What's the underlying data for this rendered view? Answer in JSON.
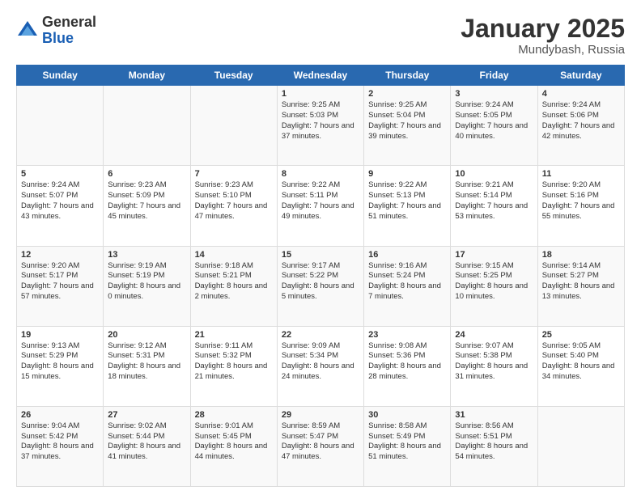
{
  "header": {
    "logo_general": "General",
    "logo_blue": "Blue",
    "month": "January 2025",
    "location": "Mundybash, Russia"
  },
  "weekdays": [
    "Sunday",
    "Monday",
    "Tuesday",
    "Wednesday",
    "Thursday",
    "Friday",
    "Saturday"
  ],
  "weeks": [
    [
      {
        "day": "",
        "info": ""
      },
      {
        "day": "",
        "info": ""
      },
      {
        "day": "",
        "info": ""
      },
      {
        "day": "1",
        "info": "Sunrise: 9:25 AM\nSunset: 5:03 PM\nDaylight: 7 hours and 37 minutes."
      },
      {
        "day": "2",
        "info": "Sunrise: 9:25 AM\nSunset: 5:04 PM\nDaylight: 7 hours and 39 minutes."
      },
      {
        "day": "3",
        "info": "Sunrise: 9:24 AM\nSunset: 5:05 PM\nDaylight: 7 hours and 40 minutes."
      },
      {
        "day": "4",
        "info": "Sunrise: 9:24 AM\nSunset: 5:06 PM\nDaylight: 7 hours and 42 minutes."
      }
    ],
    [
      {
        "day": "5",
        "info": "Sunrise: 9:24 AM\nSunset: 5:07 PM\nDaylight: 7 hours and 43 minutes."
      },
      {
        "day": "6",
        "info": "Sunrise: 9:23 AM\nSunset: 5:09 PM\nDaylight: 7 hours and 45 minutes."
      },
      {
        "day": "7",
        "info": "Sunrise: 9:23 AM\nSunset: 5:10 PM\nDaylight: 7 hours and 47 minutes."
      },
      {
        "day": "8",
        "info": "Sunrise: 9:22 AM\nSunset: 5:11 PM\nDaylight: 7 hours and 49 minutes."
      },
      {
        "day": "9",
        "info": "Sunrise: 9:22 AM\nSunset: 5:13 PM\nDaylight: 7 hours and 51 minutes."
      },
      {
        "day": "10",
        "info": "Sunrise: 9:21 AM\nSunset: 5:14 PM\nDaylight: 7 hours and 53 minutes."
      },
      {
        "day": "11",
        "info": "Sunrise: 9:20 AM\nSunset: 5:16 PM\nDaylight: 7 hours and 55 minutes."
      }
    ],
    [
      {
        "day": "12",
        "info": "Sunrise: 9:20 AM\nSunset: 5:17 PM\nDaylight: 7 hours and 57 minutes."
      },
      {
        "day": "13",
        "info": "Sunrise: 9:19 AM\nSunset: 5:19 PM\nDaylight: 8 hours and 0 minutes."
      },
      {
        "day": "14",
        "info": "Sunrise: 9:18 AM\nSunset: 5:21 PM\nDaylight: 8 hours and 2 minutes."
      },
      {
        "day": "15",
        "info": "Sunrise: 9:17 AM\nSunset: 5:22 PM\nDaylight: 8 hours and 5 minutes."
      },
      {
        "day": "16",
        "info": "Sunrise: 9:16 AM\nSunset: 5:24 PM\nDaylight: 8 hours and 7 minutes."
      },
      {
        "day": "17",
        "info": "Sunrise: 9:15 AM\nSunset: 5:25 PM\nDaylight: 8 hours and 10 minutes."
      },
      {
        "day": "18",
        "info": "Sunrise: 9:14 AM\nSunset: 5:27 PM\nDaylight: 8 hours and 13 minutes."
      }
    ],
    [
      {
        "day": "19",
        "info": "Sunrise: 9:13 AM\nSunset: 5:29 PM\nDaylight: 8 hours and 15 minutes."
      },
      {
        "day": "20",
        "info": "Sunrise: 9:12 AM\nSunset: 5:31 PM\nDaylight: 8 hours and 18 minutes."
      },
      {
        "day": "21",
        "info": "Sunrise: 9:11 AM\nSunset: 5:32 PM\nDaylight: 8 hours and 21 minutes."
      },
      {
        "day": "22",
        "info": "Sunrise: 9:09 AM\nSunset: 5:34 PM\nDaylight: 8 hours and 24 minutes."
      },
      {
        "day": "23",
        "info": "Sunrise: 9:08 AM\nSunset: 5:36 PM\nDaylight: 8 hours and 28 minutes."
      },
      {
        "day": "24",
        "info": "Sunrise: 9:07 AM\nSunset: 5:38 PM\nDaylight: 8 hours and 31 minutes."
      },
      {
        "day": "25",
        "info": "Sunrise: 9:05 AM\nSunset: 5:40 PM\nDaylight: 8 hours and 34 minutes."
      }
    ],
    [
      {
        "day": "26",
        "info": "Sunrise: 9:04 AM\nSunset: 5:42 PM\nDaylight: 8 hours and 37 minutes."
      },
      {
        "day": "27",
        "info": "Sunrise: 9:02 AM\nSunset: 5:44 PM\nDaylight: 8 hours and 41 minutes."
      },
      {
        "day": "28",
        "info": "Sunrise: 9:01 AM\nSunset: 5:45 PM\nDaylight: 8 hours and 44 minutes."
      },
      {
        "day": "29",
        "info": "Sunrise: 8:59 AM\nSunset: 5:47 PM\nDaylight: 8 hours and 47 minutes."
      },
      {
        "day": "30",
        "info": "Sunrise: 8:58 AM\nSunset: 5:49 PM\nDaylight: 8 hours and 51 minutes."
      },
      {
        "day": "31",
        "info": "Sunrise: 8:56 AM\nSunset: 5:51 PM\nDaylight: 8 hours and 54 minutes."
      },
      {
        "day": "",
        "info": ""
      }
    ]
  ]
}
